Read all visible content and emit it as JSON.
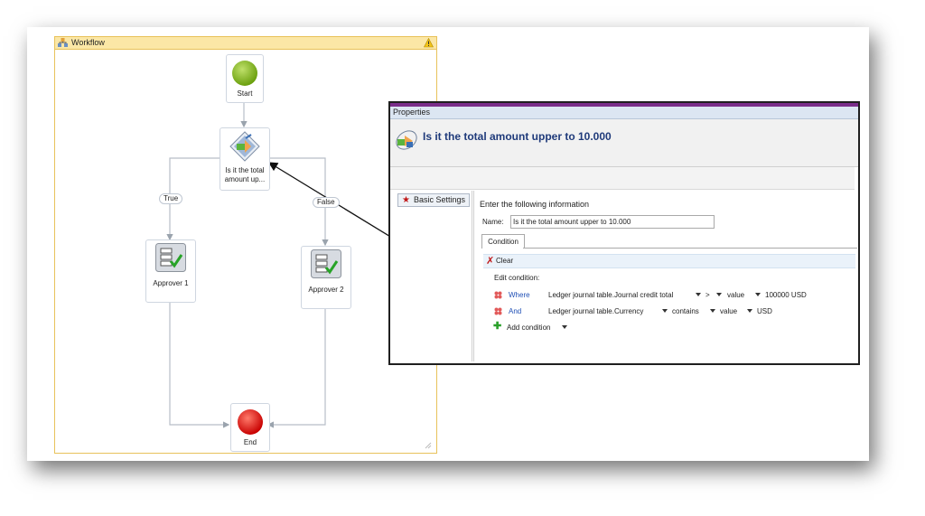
{
  "workflow": {
    "title": "Workflow",
    "nodes": {
      "start": "Start",
      "decision": "Is it the total amount up...",
      "approver1": "Approver 1",
      "approver2": "Approver 2",
      "end": "End"
    },
    "branches": {
      "true_label": "True",
      "false_label": "False"
    }
  },
  "properties": {
    "title": "Properties",
    "heading": "Is it the total amount upper to 10.000",
    "sidebar": {
      "basic_settings": "Basic Settings"
    },
    "intro": "Enter the following information",
    "name_label": "Name:",
    "name_value": "Is it the total amount upper to 10.000",
    "tab_condition": "Condition",
    "clear_label": "Clear",
    "edit_condition": "Edit condition:",
    "conditions": [
      {
        "keyword": "Where",
        "field": "Ledger journal table.Journal credit total",
        "operator": ">",
        "type": "value",
        "value": "100000 USD"
      },
      {
        "keyword": "And",
        "field": "Ledger journal table.Currency",
        "operator": "contains",
        "type": "value",
        "value": "USD"
      }
    ],
    "add_condition": "Add condition"
  },
  "colors": {
    "start": "#7ab317",
    "end": "#e01010",
    "accent": "#1f3a7a",
    "header": "#fbe7a6"
  }
}
